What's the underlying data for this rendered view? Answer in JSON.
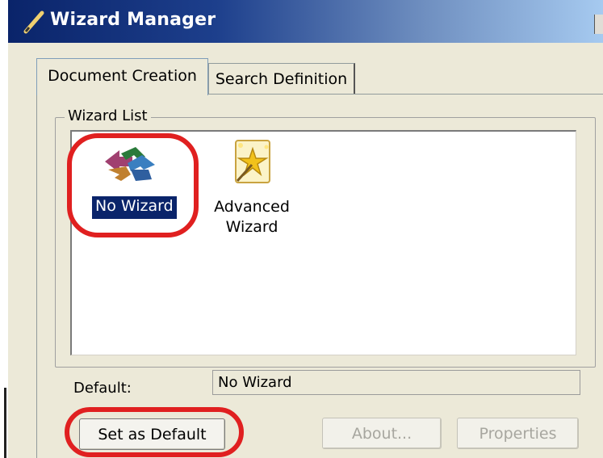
{
  "window": {
    "title": "Wizard Manager",
    "icon": "pencil-icon"
  },
  "tabs": [
    {
      "label": "Document Creation",
      "active": true
    },
    {
      "label": "Search Definition",
      "active": false
    }
  ],
  "wizard_list": {
    "group_label": "Wizard List",
    "items": [
      {
        "label": "No Wizard",
        "icon": "arrows-icon",
        "selected": true
      },
      {
        "label": "Advanced Wizard",
        "label_lines": [
          "Advanced",
          "Wizard"
        ],
        "icon": "magic-wand-icon",
        "selected": false
      }
    ]
  },
  "default": {
    "label": "Default:",
    "value": "No Wizard"
  },
  "buttons": {
    "set_default": "Set as Default",
    "about": "About...",
    "properties": "Properties"
  },
  "colors": {
    "highlight_ring": "#e02020",
    "selection": "#0a246a",
    "titlebar": "#0a246a"
  }
}
